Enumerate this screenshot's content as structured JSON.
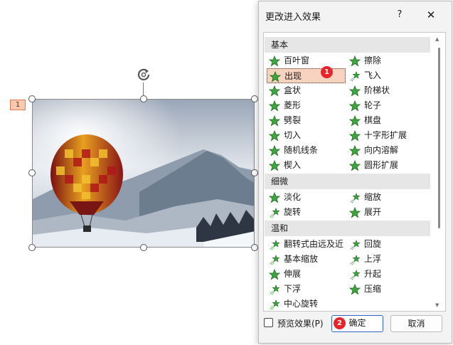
{
  "slide": {
    "animation_tag": "1"
  },
  "dialog": {
    "title": "更改进入效果",
    "help_label": "?",
    "close_label": "✕",
    "sections": [
      {
        "header": "基本",
        "items": [
          {
            "label": "百叶窗",
            "icon": "star-green-icon"
          },
          {
            "label": "擦除",
            "icon": "star-green-icon"
          },
          {
            "label": "出现",
            "icon": "star-green-icon",
            "selected": true
          },
          {
            "label": "飞入",
            "icon": "star-fly-icon"
          },
          {
            "label": "盒状",
            "icon": "star-green-icon"
          },
          {
            "label": "阶梯状",
            "icon": "star-green-icon"
          },
          {
            "label": "菱形",
            "icon": "star-green-icon"
          },
          {
            "label": "轮子",
            "icon": "star-green-icon"
          },
          {
            "label": "劈裂",
            "icon": "star-green-icon"
          },
          {
            "label": "棋盘",
            "icon": "star-green-icon"
          },
          {
            "label": "切入",
            "icon": "star-green-icon"
          },
          {
            "label": "十字形扩展",
            "icon": "star-green-icon"
          },
          {
            "label": "随机线条",
            "icon": "star-green-icon"
          },
          {
            "label": "向内溶解",
            "icon": "star-green-icon"
          },
          {
            "label": "楔入",
            "icon": "star-green-icon"
          },
          {
            "label": "圆形扩展",
            "icon": "star-green-icon"
          }
        ]
      },
      {
        "header": "细微",
        "items": [
          {
            "label": "淡化",
            "icon": "star-green-icon"
          },
          {
            "label": "缩放",
            "icon": "star-fly-icon"
          },
          {
            "label": "旋转",
            "icon": "star-fly-icon"
          },
          {
            "label": "展开",
            "icon": "star-green-icon"
          }
        ]
      },
      {
        "header": "温和",
        "items": [
          {
            "label": "翻转式由远及近",
            "icon": "star-fly-icon"
          },
          {
            "label": "回旋",
            "icon": "star-fly-icon"
          },
          {
            "label": "基本缩放",
            "icon": "star-fly-icon"
          },
          {
            "label": "上浮",
            "icon": "star-fly-icon"
          },
          {
            "label": "伸展",
            "icon": "star-green-icon"
          },
          {
            "label": "升起",
            "icon": "star-fly-icon"
          },
          {
            "label": "下浮",
            "icon": "star-fly-icon"
          },
          {
            "label": "压缩",
            "icon": "star-green-icon"
          },
          {
            "label": "中心旋转",
            "icon": "star-fly-icon"
          }
        ]
      }
    ],
    "preview_label": "预览效果(P)",
    "preview_checked": false,
    "ok_label": "确定",
    "cancel_label": "取消"
  },
  "badges": {
    "first": "1",
    "second": "2"
  },
  "colors": {
    "accent": "#2f64c4",
    "star_green": "#3da63d",
    "selected_bg": "#f8d3bf",
    "badge_red": "#e8232b"
  }
}
